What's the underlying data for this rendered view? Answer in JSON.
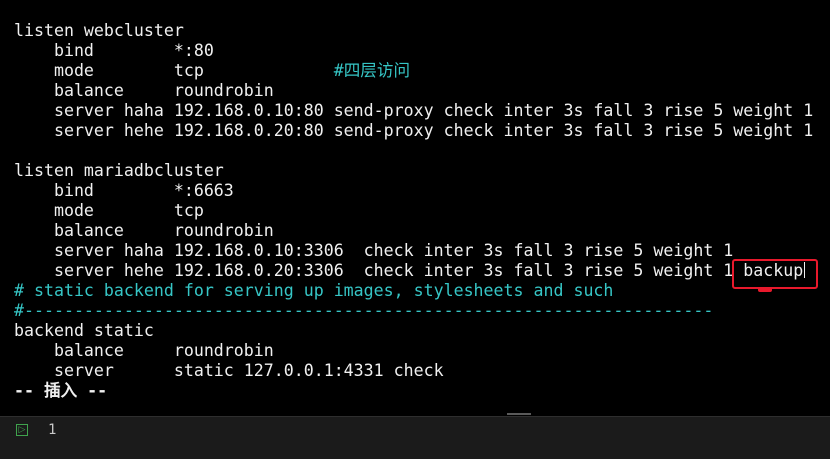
{
  "editor": {
    "lines": [
      {
        "segments": [
          {
            "text": "listen webcluster"
          }
        ]
      },
      {
        "segments": [
          {
            "text": "    bind        *:80"
          }
        ]
      },
      {
        "segments": [
          {
            "text": "    mode        tcp             "
          },
          {
            "text": "#",
            "style": "comment"
          },
          {
            "text": "四层访问",
            "style": "cjk"
          }
        ]
      },
      {
        "segments": [
          {
            "text": "    balance     roundrobin"
          }
        ]
      },
      {
        "segments": [
          {
            "text": "    server haha 192.168.0.10:80 send-proxy check inter 3s fall 3 rise 5 weight 1"
          }
        ]
      },
      {
        "segments": [
          {
            "text": "    server hehe 192.168.0.20:80 send-proxy check inter 3s fall 3 rise 5 weight 1"
          }
        ]
      },
      {
        "segments": [
          {
            "text": ""
          }
        ]
      },
      {
        "segments": [
          {
            "text": "listen mariadbcluster"
          }
        ]
      },
      {
        "segments": [
          {
            "text": "    bind        *:6663"
          }
        ]
      },
      {
        "segments": [
          {
            "text": "    mode        tcp"
          }
        ]
      },
      {
        "segments": [
          {
            "text": "    balance     roundrobin"
          }
        ]
      },
      {
        "segments": [
          {
            "text": "    server haha 192.168.0.10:3306  check inter 3s fall 3 rise 5 weight 1"
          }
        ]
      },
      {
        "segments": [
          {
            "text": "    server hehe 192.168.0.20:3306  check inter 3s fall 3 rise 5 weight 1 backup"
          }
        ],
        "cursor": true
      },
      {
        "segments": [
          {
            "text": "# static backend for serving up images, stylesheets and such",
            "style": "comment"
          }
        ]
      },
      {
        "segments": [
          {
            "text": "#---------------------------------------------------------------------",
            "style": "comment"
          }
        ]
      },
      {
        "segments": [
          {
            "text": "backend static"
          }
        ]
      },
      {
        "segments": [
          {
            "text": "    balance     roundrobin"
          }
        ]
      },
      {
        "segments": [
          {
            "text": "    server      static 127.0.0.1:4331 check"
          }
        ]
      },
      {
        "segments": [
          {
            "text": "-- ",
            "style": "bold"
          },
          {
            "text": "插入",
            "style": "cjk-mode"
          },
          {
            "text": " --",
            "style": "bold"
          }
        ]
      }
    ]
  },
  "annotation": {
    "color": "#e8192c",
    "highlighted_text": "backup"
  },
  "bottom_panel": {
    "icon": "terminal-prompt-icon",
    "icon_glyph": "▷",
    "count": "1"
  }
}
